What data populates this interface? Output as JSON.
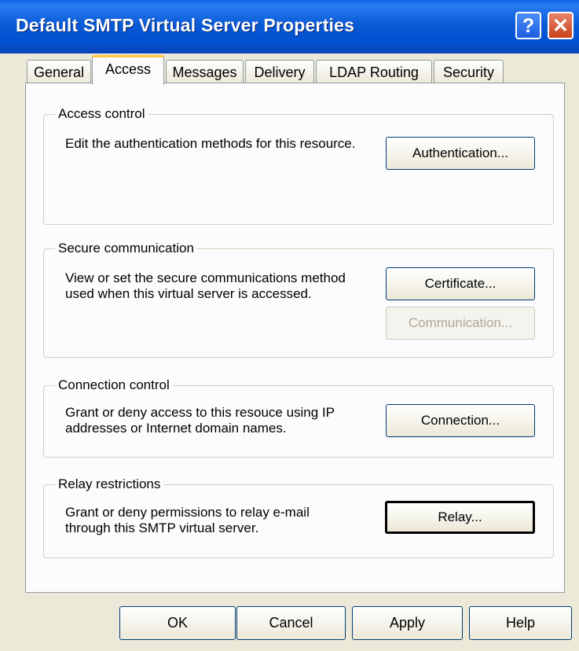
{
  "window": {
    "title": "Default SMTP Virtual Server Properties",
    "help_glyph": "?",
    "close_glyph": "✕"
  },
  "tabs": [
    {
      "label": "General"
    },
    {
      "label": "Access",
      "active": true
    },
    {
      "label": "Messages"
    },
    {
      "label": "Delivery"
    },
    {
      "label": "LDAP Routing"
    },
    {
      "label": "Security"
    }
  ],
  "groups": {
    "access_control": {
      "title": "Access control",
      "description": "Edit the authentication methods for this resource.",
      "button": "Authentication..."
    },
    "secure_communication": {
      "title": "Secure communication",
      "description": "View or set the secure communications method used when this virtual server is accessed.",
      "button_certificate": "Certificate...",
      "button_communication": "Communication..."
    },
    "connection_control": {
      "title": "Connection control",
      "description": "Grant or deny access to this resouce using IP addresses or Internet domain names.",
      "button": "Connection..."
    },
    "relay_restrictions": {
      "title": "Relay restrictions",
      "description": "Grant or deny permissions to relay e-mail through this SMTP virtual server.",
      "button": "Relay..."
    }
  },
  "footer": {
    "ok": "OK",
    "cancel": "Cancel",
    "apply": "Apply",
    "help": "Help"
  },
  "colors": {
    "titlebar": "#0a5bd6",
    "dialog_bg": "#ece9d8",
    "tab_highlight": "#ffc83c"
  }
}
